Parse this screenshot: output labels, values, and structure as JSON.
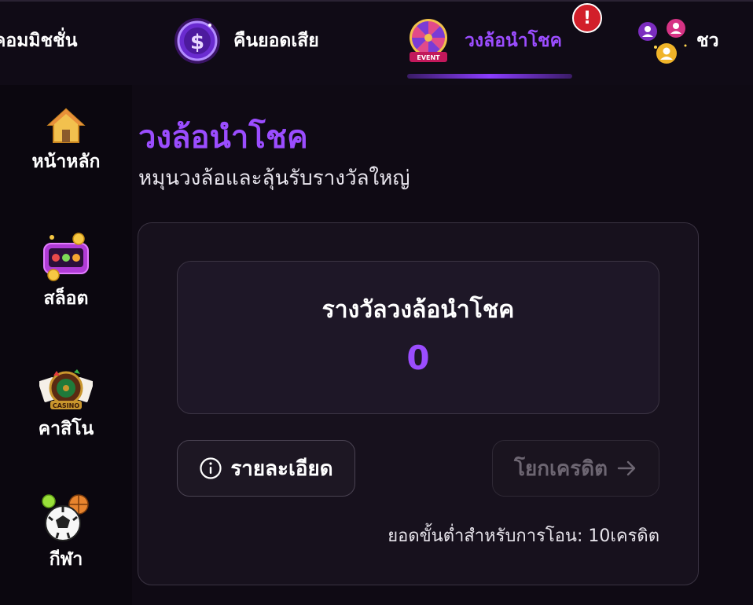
{
  "top_nav": {
    "tabs": [
      {
        "label": "คอมมิชชั่น",
        "icon": "commission-icon"
      },
      {
        "label": "คืนยอดเสีย",
        "icon": "dollar-coin-icon"
      },
      {
        "label": "วงล้อนำโชค",
        "icon": "prize-wheel-icon",
        "active": true,
        "alert": "!",
        "wheel_banner": "EVENT"
      },
      {
        "label": "ชว",
        "icon": "invite-friends-icon"
      }
    ],
    "active_color": "#9b4dff",
    "alert_color": "#d21f2a"
  },
  "sidebar": {
    "items": [
      {
        "label": "หน้าหลัก",
        "icon": "home-icon"
      },
      {
        "label": "สล็อต",
        "icon": "slot-machine-icon"
      },
      {
        "label": "คาสิโน",
        "icon": "casino-roulette-icon",
        "emblem_text": "CASINO"
      },
      {
        "label": "กีฬา",
        "icon": "sports-ball-icon"
      }
    ]
  },
  "page": {
    "title": "วงล้อนำโชค",
    "subtitle": "หมุนวงล้อและลุ้นรับรางวัลใหญ่"
  },
  "reward": {
    "title": "รางวัลวงล้อนำโชค",
    "amount": "0"
  },
  "actions": {
    "details_label": "รายละเอียด",
    "details_icon": "info-circle-icon",
    "transfer_label": "โยกเครดิต",
    "transfer_icon": "arrow-right-icon",
    "transfer_enabled": false
  },
  "min_transfer_note": "ยอดขั้นต่ำสำหรับการโอน: 10เครดิต",
  "colors": {
    "background": "#0f0a14",
    "accent": "#9b4dff",
    "card": "#17111d"
  }
}
